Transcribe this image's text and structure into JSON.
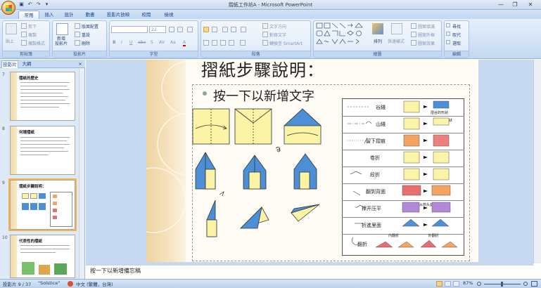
{
  "window": {
    "title": "摺紙工作坊A - Microsoft PowerPoint",
    "min": "—",
    "restore": "❐",
    "close": "✕"
  },
  "qat": {
    "save": "▣",
    "undo": "↶",
    "redo": "↷",
    "more": "▾"
  },
  "tabs": [
    "常用",
    "插入",
    "設計",
    "動畫",
    "投影片放映",
    "校閱",
    "檢視"
  ],
  "active_tab": "常用",
  "ribbon": {
    "clipboard": {
      "label": "剪貼簿",
      "paste": "貼上",
      "cut": "剪下",
      "copy": "複製",
      "format_painter": "複製格式"
    },
    "slides": {
      "label": "投影片",
      "new_slide": "新增\n投影片",
      "layout": "版面配置",
      "reset": "重設",
      "delete": "刪除"
    },
    "font": {
      "label": "字型",
      "size": "22",
      "buttons": [
        "B",
        "I",
        "U",
        "abe",
        "S",
        "AV",
        "Aa",
        "A"
      ]
    },
    "paragraph": {
      "label": "段落",
      "text_direction": "文字方向",
      "align_text": "對齊文字",
      "smartart": "轉換至 SmartArt"
    },
    "drawing": {
      "label": "繪圖",
      "arrange": "排列",
      "quick_styles": "快速樣式",
      "fill": "圖案填滿",
      "outline": "圖案外框",
      "effects": "圖案效果"
    },
    "editing": {
      "label": "編輯",
      "find": "尋找",
      "replace": "取代",
      "select": "選取"
    }
  },
  "pane": {
    "tab_slides": "投影片",
    "tab_outline": "大綱",
    "close": "×"
  },
  "thumbnails": [
    {
      "num": "7",
      "title": "摺紙的歷史"
    },
    {
      "num": "8",
      "title": "何謂摺紙"
    },
    {
      "num": "9",
      "title": "摺紙步驟說明："
    },
    {
      "num": "10",
      "title": "代表性的摺紙"
    }
  ],
  "slide": {
    "title": "摺紙步驟說明：",
    "bullet": "按一下以新增文字",
    "legend": [
      {
        "label": "谷綫",
        "note": "摺谷的形狀"
      },
      {
        "label": "山綫",
        "note": "摺山的形狀"
      },
      {
        "label": "留下摺痕",
        "note": ""
      },
      {
        "label": "卷折",
        "note": ""
      },
      {
        "label": "段折",
        "note": ""
      },
      {
        "label": "翻到背面",
        "note": ""
      },
      {
        "label": "撑开压平",
        "note": "从箭头处打开压平"
      },
      {
        "label": "折進里面",
        "note": ""
      },
      {
        "label": "翻折",
        "note": "内翻折  外翻折"
      }
    ]
  },
  "notes": "按一下以新增備忘稿",
  "status": {
    "slide": "投影片 9 / 37",
    "theme": "\"Solstice\"",
    "lang": "中文 (繁體，台灣)",
    "zoom": "87%"
  },
  "colors": {
    "ribbon": "#dbe7f6",
    "paper_yellow": "#fbf3a6",
    "paper_blue": "#4d8fd6",
    "selection": "#f4b34b"
  }
}
